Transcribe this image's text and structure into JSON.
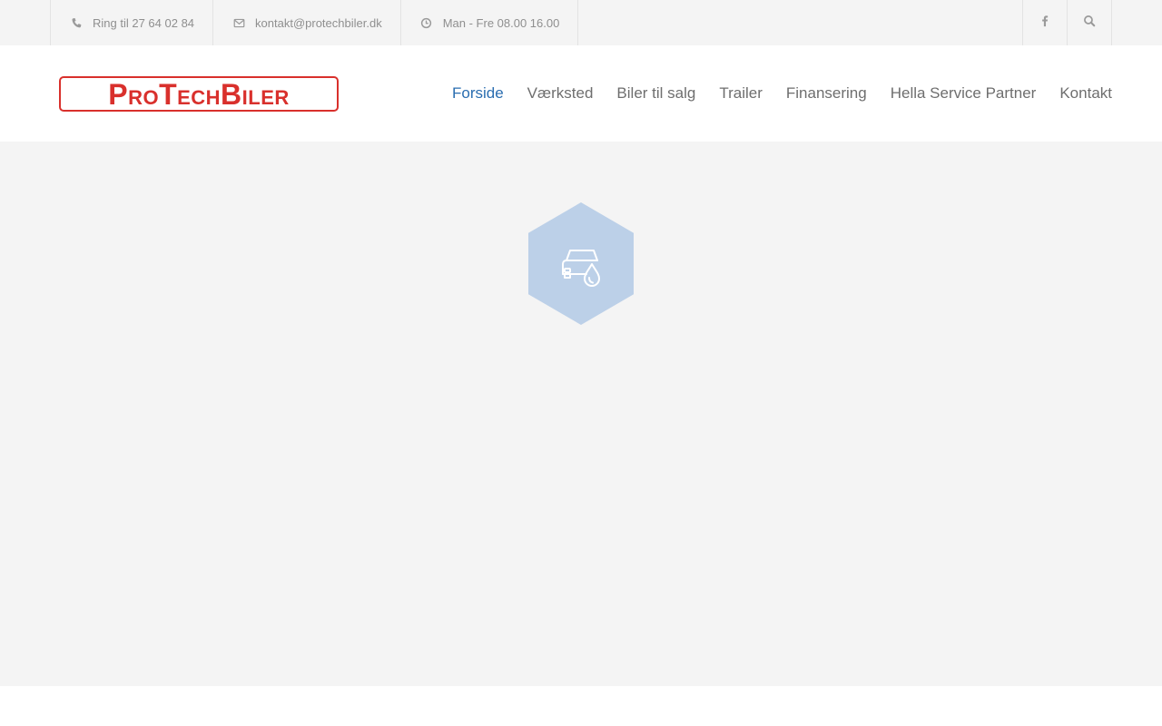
{
  "topbar": {
    "phone": {
      "icon": "phone-icon",
      "text": "Ring til 27 64 02 84"
    },
    "email": {
      "icon": "envelope-icon",
      "text": "kontakt@protechbiler.dk"
    },
    "hours": {
      "icon": "clock-icon",
      "text": "Man - Fre 08.00 16.00"
    },
    "social": {
      "icon": "facebook-icon"
    },
    "search": {
      "icon": "search-icon"
    }
  },
  "header": {
    "logo_text": "ProTechBiler",
    "nav": [
      {
        "label": "Forside",
        "active": true
      },
      {
        "label": "Værksted",
        "active": false
      },
      {
        "label": "Biler til salg",
        "active": false
      },
      {
        "label": "Trailer",
        "active": false
      },
      {
        "label": "Finansering",
        "active": false
      },
      {
        "label": "Hella Service Partner",
        "active": false
      },
      {
        "label": "Kontakt",
        "active": false
      }
    ]
  },
  "main": {
    "feature_icon": "car-wash-drop-icon"
  },
  "colors": {
    "accent": "#2a6db0",
    "logo_red": "#d9302c",
    "hex_fill": "#bcd0e8",
    "topbar_bg": "#f4f4f4",
    "text_muted": "#8f8f8f"
  }
}
